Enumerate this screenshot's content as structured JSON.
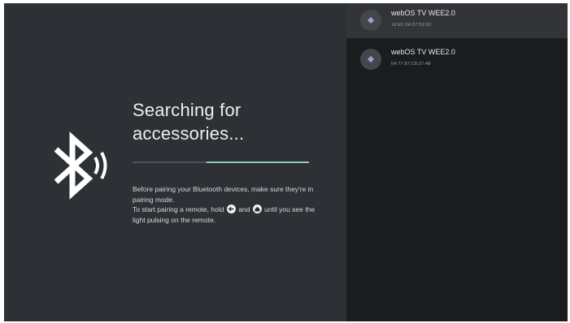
{
  "title": "Searching for accessories...",
  "progress": 0.58,
  "instructions": {
    "line1": "Before pairing your Bluetooth devices, make sure they're in pairing mode.",
    "line2_pre": "To start pairing a remote, hold",
    "line2_mid": "and",
    "line2_post": "until you see the light pulsing on the remote.",
    "back_button_icon": "back-arrow-icon",
    "home_button_icon": "home-icon"
  },
  "devices": [
    {
      "name": "webOS TV WEE2.0",
      "address": "18:EF:3A:07:59:62",
      "icon": "bluetooth-device-icon",
      "selected": true
    },
    {
      "name": "webOS TV WEE2.0",
      "address": "54:77:87:C8:27:48",
      "icon": "bluetooth-device-icon",
      "selected": false
    }
  ],
  "colors": {
    "left_bg": "#2d3035",
    "right_bg": "#1b1c1d",
    "selected_bg": "#323437",
    "progress_accent": "#8fc9ba"
  }
}
